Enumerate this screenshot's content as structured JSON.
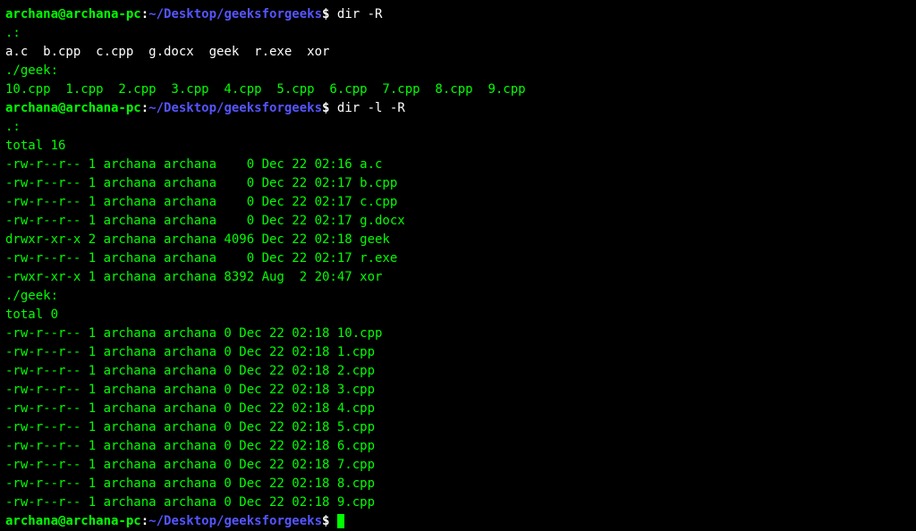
{
  "prompt": {
    "userhost": "archana@archana-pc",
    "colon": ":",
    "path": "~/Desktop/geeksforgeeks",
    "dollar": "$"
  },
  "cmd1": "dir -R",
  "out1": {
    "dir_root": ".:",
    "root_files": "a.c  b.cpp  c.cpp  g.docx  geek  r.exe  xor",
    "blank1": "",
    "dir_geek": "./geek:",
    "geek_files": "10.cpp  1.cpp  2.cpp  3.cpp  4.cpp  5.cpp  6.cpp  7.cpp  8.cpp  9.cpp"
  },
  "cmd2": "dir -l -R",
  "out2": {
    "dir_root": ".:",
    "total_root": "total 16",
    "rows_root": [
      "-rw-r--r-- 1 archana archana    0 Dec 22 02:16 a.c",
      "-rw-r--r-- 1 archana archana    0 Dec 22 02:17 b.cpp",
      "-rw-r--r-- 1 archana archana    0 Dec 22 02:17 c.cpp",
      "-rw-r--r-- 1 archana archana    0 Dec 22 02:17 g.docx",
      "drwxr-xr-x 2 archana archana 4096 Dec 22 02:18 geek",
      "-rw-r--r-- 1 archana archana    0 Dec 22 02:17 r.exe",
      "-rwxr-xr-x 1 archana archana 8392 Aug  2 20:47 xor"
    ],
    "blank1": "",
    "dir_geek": "./geek:",
    "total_geek": "total 0",
    "rows_geek": [
      "-rw-r--r-- 1 archana archana 0 Dec 22 02:18 10.cpp",
      "-rw-r--r-- 1 archana archana 0 Dec 22 02:18 1.cpp",
      "-rw-r--r-- 1 archana archana 0 Dec 22 02:18 2.cpp",
      "-rw-r--r-- 1 archana archana 0 Dec 22 02:18 3.cpp",
      "-rw-r--r-- 1 archana archana 0 Dec 22 02:18 4.cpp",
      "-rw-r--r-- 1 archana archana 0 Dec 22 02:18 5.cpp",
      "-rw-r--r-- 1 archana archana 0 Dec 22 02:18 6.cpp",
      "-rw-r--r-- 1 archana archana 0 Dec 22 02:18 7.cpp",
      "-rw-r--r-- 1 archana archana 0 Dec 22 02:18 8.cpp",
      "-rw-r--r-- 1 archana archana 0 Dec 22 02:18 9.cpp"
    ]
  }
}
